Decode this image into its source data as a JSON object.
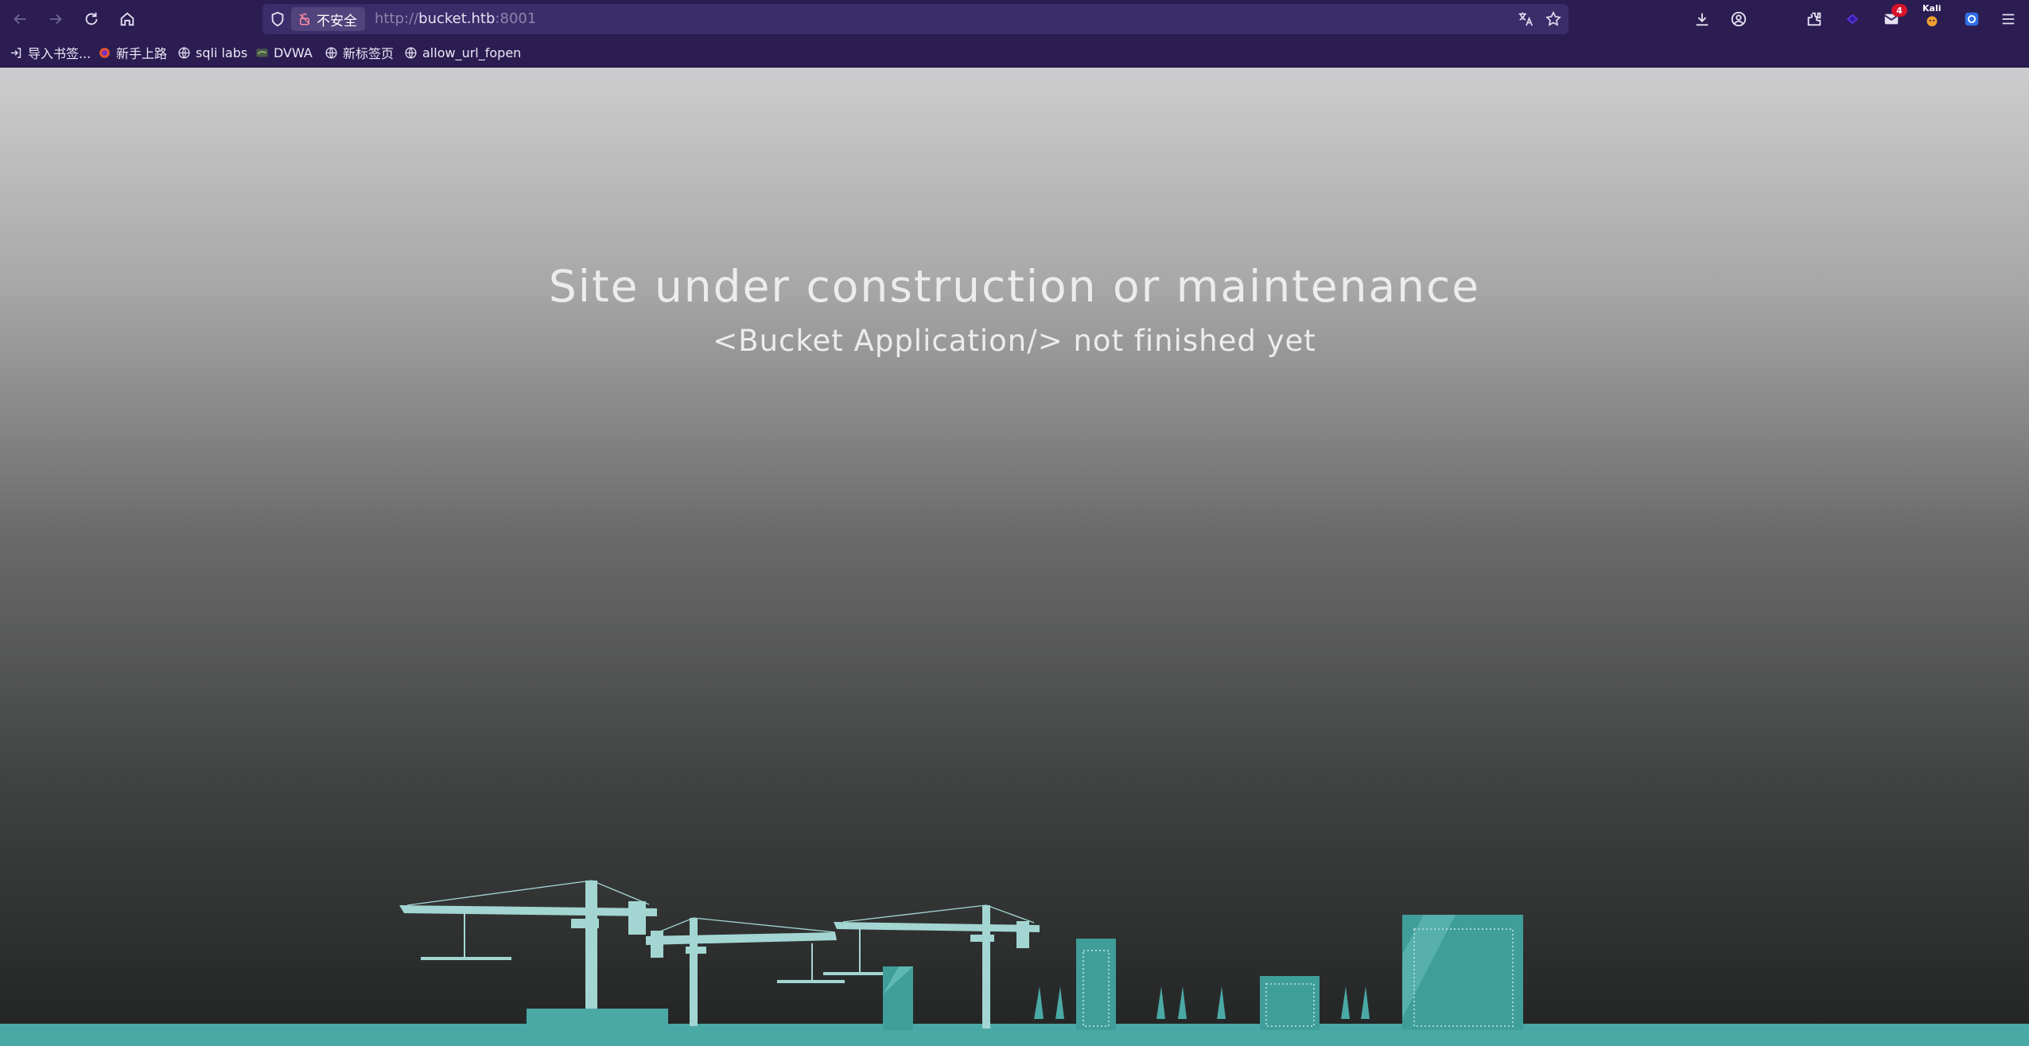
{
  "browser": {
    "url_scheme": "http://",
    "url_host": "bucket.htb",
    "url_port": ":8001",
    "security_label": "不安全",
    "downloads_badge": "4",
    "kali_label": "Kali",
    "icons": [
      "back-icon",
      "forward-icon",
      "reload-icon",
      "home-icon",
      "shield-icon",
      "lock-broken-icon",
      "translate-icon",
      "star-icon",
      "download-icon",
      "account-icon",
      "extensions-icon",
      "pocket-icon",
      "mail-icon",
      "kali-extension-icon",
      "container-icon",
      "menu-icon"
    ]
  },
  "bookmarks": [
    {
      "label": "导入书签...",
      "icon": "import-icon"
    },
    {
      "label": "新手上路",
      "icon": "firefox-icon"
    },
    {
      "label": "sqli labs",
      "icon": "globe-icon"
    },
    {
      "label": "DVWA",
      "icon": "dvwa-icon"
    },
    {
      "label": "新标签页",
      "icon": "globe-icon"
    },
    {
      "label": "allow_url_fopen",
      "icon": "globe-icon"
    }
  ],
  "page": {
    "headline": "Site under construction or maintenance",
    "subline": "<Bucket Application/> not finished yet",
    "colors": {
      "skyline": "#4aa9a5",
      "crane": "#a3d6d2",
      "building": "#3f9e9a",
      "ground": "#4aa9a5",
      "bg_top": "#cdcdcf",
      "bg_bottom": "#222424"
    }
  }
}
